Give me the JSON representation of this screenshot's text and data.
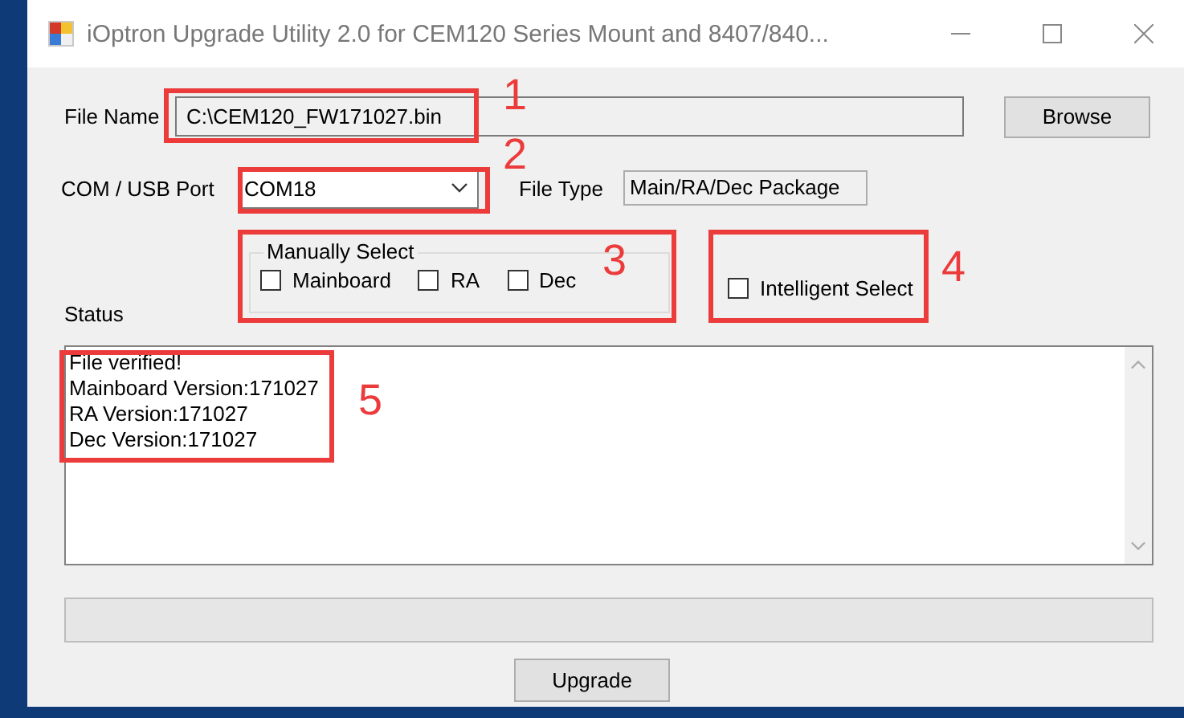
{
  "window": {
    "title": "iOptron Upgrade Utility  2.0 for CEM120 Series Mount and 8407/840..."
  },
  "file_name": {
    "label": "File Name",
    "value": "C:\\CEM120_FW171027.bin"
  },
  "browse_button": "Browse",
  "port": {
    "label": "COM / USB Port",
    "value": "COM18"
  },
  "file_type": {
    "label": "File Type",
    "value": "Main/RA/Dec Package"
  },
  "manual_select": {
    "title": "Manually Select",
    "options": [
      {
        "label": "Mainboard",
        "checked": false
      },
      {
        "label": "RA",
        "checked": false
      },
      {
        "label": "Dec",
        "checked": false
      }
    ]
  },
  "intelligent_select": {
    "label": "Intelligent Select",
    "checked": false
  },
  "status": {
    "label": "Status",
    "lines": [
      "File verified!",
      "Mainboard Version:171027",
      "RA Version:171027",
      "Dec Version:171027"
    ]
  },
  "upgrade_button": "Upgrade",
  "annotations": [
    {
      "number": "1"
    },
    {
      "number": "2"
    },
    {
      "number": "3"
    },
    {
      "number": "4"
    },
    {
      "number": "5"
    }
  ]
}
